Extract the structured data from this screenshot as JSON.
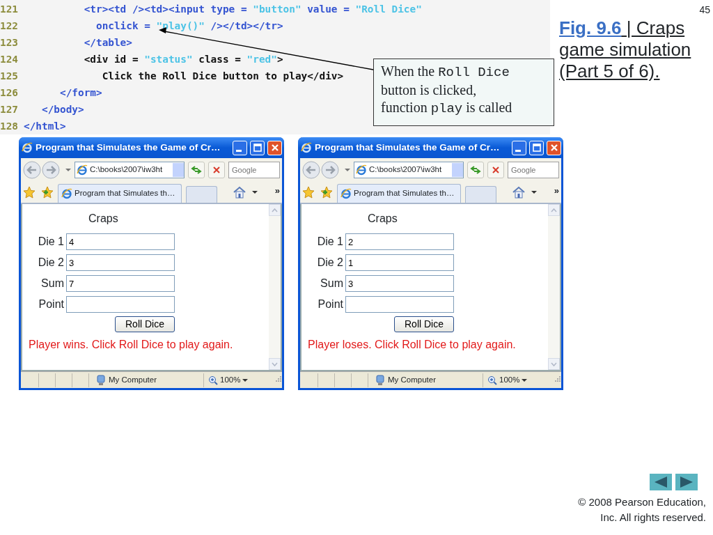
{
  "code_listing": {
    "lines": [
      {
        "number": "121",
        "segments": [
          {
            "text": "          <tr><td /><td><input type = ",
            "kind": "markup"
          },
          {
            "text": "\"button\"",
            "kind": "string"
          },
          {
            "text": " value = ",
            "kind": "markup"
          },
          {
            "text": "\"Roll Dice\"",
            "kind": "string"
          }
        ]
      },
      {
        "number": "122",
        "segments": [
          {
            "text": "            onclick = ",
            "kind": "markup"
          },
          {
            "text": "\"play()\"",
            "kind": "string"
          },
          {
            "text": " /></td></tr>",
            "kind": "markup"
          }
        ]
      },
      {
        "number": "123",
        "segments": [
          {
            "text": "          </table>",
            "kind": "markup"
          }
        ]
      },
      {
        "number": "124",
        "segments": [
          {
            "text": "          <div id = ",
            "kind": "plain"
          },
          {
            "text": "\"status\"",
            "kind": "string"
          },
          {
            "text": " class = ",
            "kind": "plain"
          },
          {
            "text": "\"red\"",
            "kind": "string"
          },
          {
            "text": ">",
            "kind": "plain"
          }
        ]
      },
      {
        "number": "125",
        "segments": [
          {
            "text": "             Click the Roll Dice button to play</div>",
            "kind": "plain"
          }
        ]
      },
      {
        "number": "126",
        "segments": [
          {
            "text": "      </form>",
            "kind": "markup"
          }
        ]
      },
      {
        "number": "127",
        "segments": [
          {
            "text": "   </body>",
            "kind": "markup"
          }
        ]
      },
      {
        "number": "128",
        "segments": [
          {
            "text": "</html>",
            "kind": "markup"
          }
        ]
      }
    ],
    "callout": [
      [
        {
          "text": "When the ",
          "kind": "prose"
        },
        {
          "text": "Roll Dice",
          "kind": "code"
        }
      ],
      [
        {
          "text": "button is clicked,",
          "kind": "prose"
        }
      ],
      [
        {
          "text": "function ",
          "kind": "prose"
        },
        {
          "text": "play",
          "kind": "code"
        },
        {
          "text": " is called",
          "kind": "prose"
        }
      ]
    ]
  },
  "page_number": "45",
  "caption": {
    "figure_link": "Fig. 9.6",
    "text": " | Craps game simulation (Part 5 of 6)."
  },
  "browser_windows": [
    {
      "title": "Program that Simulates the Game of Cr…",
      "address": "C:\\books\\2007\\iw3ht",
      "search_placeholder": "Google",
      "tab_label": "Program that Simulates th…",
      "more": "»",
      "page": {
        "heading": "Craps",
        "fields": [
          {
            "label": "Die 1",
            "value": "4"
          },
          {
            "label": "Die 2",
            "value": "3"
          },
          {
            "label": "Sum",
            "value": "7"
          },
          {
            "label": "Point"
          }
        ],
        "button": "Roll Dice",
        "message": "Player wins. Click Roll Dice to play again."
      },
      "status_zone": "My Computer",
      "zoom": "100%"
    },
    {
      "title": "Program that Simulates the Game of Cr…",
      "address": "C:\\books\\2007\\iw3ht",
      "search_placeholder": "Google",
      "tab_label": "Program that Simulates th…",
      "more": "»",
      "page": {
        "heading": "Craps",
        "fields": [
          {
            "label": "Die 1",
            "value": "2"
          },
          {
            "label": "Die 2",
            "value": "1"
          },
          {
            "label": "Sum",
            "value": "3"
          },
          {
            "label": "Point"
          }
        ],
        "button": "Roll Dice",
        "message": "Player loses. Click Roll Dice to play again."
      },
      "status_zone": "My Computer",
      "zoom": "100%"
    }
  ],
  "copyright": [
    "© 2008 Pearson Education,",
    "Inc.  All rights reserved."
  ]
}
